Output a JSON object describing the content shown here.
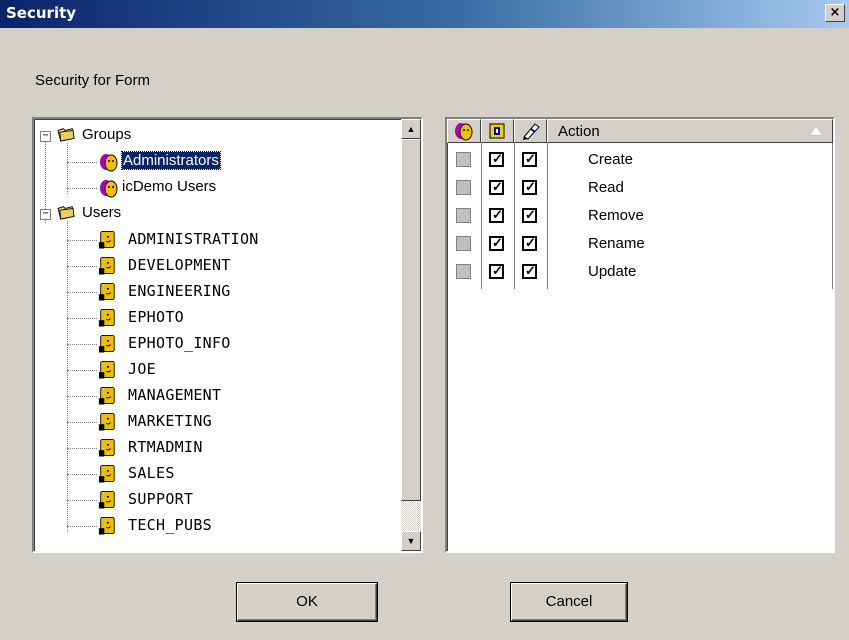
{
  "window": {
    "title": "Security",
    "close_glyph": "×"
  },
  "dialog": {
    "subtitle": "Security for Form"
  },
  "tree": {
    "groups_label": "Groups",
    "groups": [
      {
        "label": "Administrators",
        "selected": true,
        "icon": "group-icon"
      },
      {
        "label": "icDemo Users",
        "selected": false,
        "icon": "group-icon"
      }
    ],
    "users_label": "Users",
    "users": [
      "ADMINISTRATION",
      "DEVELOPMENT",
      "ENGINEERING",
      "EPHOTO",
      "EPHOTO_INFO",
      "JOE",
      "MANAGEMENT",
      "MARKETING",
      "RTMADMIN",
      "SALES",
      "SUPPORT",
      "TECH_PUBS"
    ],
    "expander_glyph": "−"
  },
  "permissions": {
    "header_icons": [
      "group-icon",
      "lock-icon",
      "pencil-icon"
    ],
    "column_label": "Action",
    "rows": [
      {
        "action": "Create",
        "col1": false,
        "col2": true,
        "col3": true
      },
      {
        "action": "Read",
        "col1": false,
        "col2": true,
        "col3": true
      },
      {
        "action": "Remove",
        "col1": false,
        "col2": true,
        "col3": true
      },
      {
        "action": "Rename",
        "col1": false,
        "col2": true,
        "col3": true
      },
      {
        "action": "Update",
        "col1": false,
        "col2": true,
        "col3": true
      }
    ],
    "tick_glyph": "✓"
  },
  "buttons": {
    "ok": "OK",
    "cancel": "Cancel"
  },
  "colors": {
    "selection": "#0a246a",
    "face": "#d4d0c8",
    "title_start": "#0a246a",
    "title_end": "#a6caf0"
  }
}
